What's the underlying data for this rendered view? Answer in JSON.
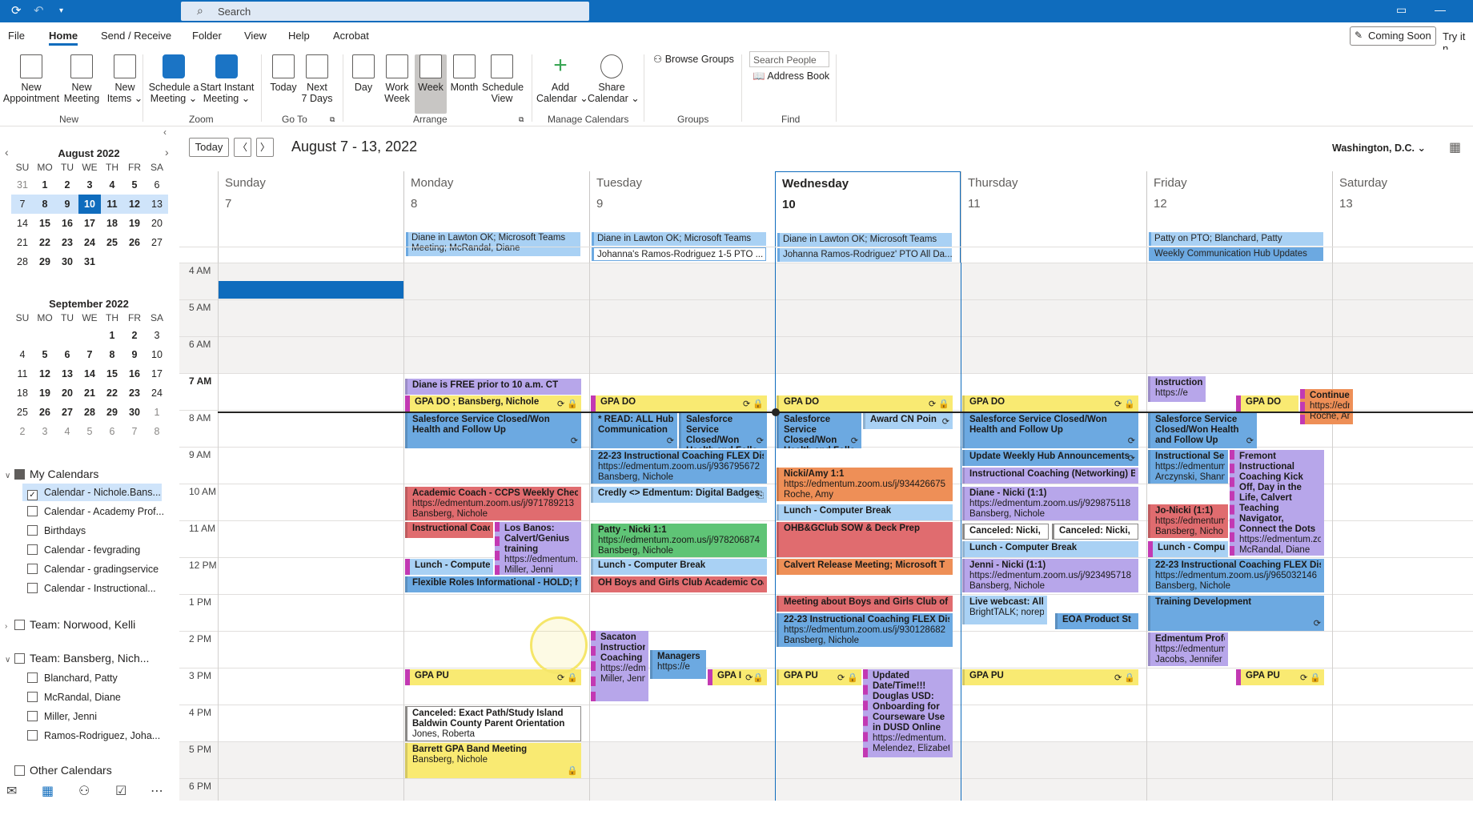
{
  "titlebar": {
    "search_placeholder": "Search",
    "icons": [
      "sync-icon",
      "undo-icon",
      "customize-icon",
      "restore-icon",
      "minimize-icon"
    ]
  },
  "menu": {
    "items": [
      "File",
      "Home",
      "Send / Receive",
      "Folder",
      "View",
      "Help",
      "Acrobat"
    ],
    "active": "Home",
    "coming_soon": "Coming Soon",
    "try_it": "Try it n"
  },
  "ribbon": {
    "new": {
      "appointment": "New\nAppointment",
      "meeting": "New\nMeeting",
      "items": "New\nItems ⌄",
      "group": "New"
    },
    "zoom": {
      "schedule": "Schedule a\nMeeting ⌄",
      "instant": "Start Instant\nMeeting ⌄",
      "group": "Zoom"
    },
    "goto": {
      "today": "Today",
      "next7": "Next\n7 Days",
      "group": "Go To"
    },
    "arrange": {
      "day": "Day",
      "workweek": "Work\nWeek",
      "week": "Week",
      "month": "Month",
      "schedule": "Schedule\nView",
      "group": "Arrange"
    },
    "manage": {
      "add": "Add\nCalendar ⌄",
      "share": "Share\nCalendar ⌄",
      "group": "Manage Calendars"
    },
    "groups": {
      "browse": "Browse Groups",
      "group": "Groups"
    },
    "find": {
      "search_people": "Search People",
      "address_book": "Address Book",
      "group": "Find"
    }
  },
  "mini_cals": [
    {
      "title": "August 2022",
      "dow": [
        "SU",
        "MO",
        "TU",
        "WE",
        "TH",
        "FR",
        "SA"
      ],
      "weeks": [
        [
          "31",
          "1",
          "2",
          "3",
          "4",
          "5",
          "6"
        ],
        [
          "7",
          "8",
          "9",
          "10",
          "11",
          "12",
          "13"
        ],
        [
          "14",
          "15",
          "16",
          "17",
          "18",
          "19",
          "20"
        ],
        [
          "21",
          "22",
          "23",
          "24",
          "25",
          "26",
          "27"
        ],
        [
          "28",
          "29",
          "30",
          "31",
          "",
          "",
          ""
        ]
      ]
    },
    {
      "title": "September 2022",
      "dow": [
        "SU",
        "MO",
        "TU",
        "WE",
        "TH",
        "FR",
        "SA"
      ],
      "weeks": [
        [
          "",
          "",
          "",
          "",
          "1",
          "2",
          "3"
        ],
        [
          "4",
          "5",
          "6",
          "7",
          "8",
          "9",
          "10"
        ],
        [
          "11",
          "12",
          "13",
          "14",
          "15",
          "16",
          "17"
        ],
        [
          "18",
          "19",
          "20",
          "21",
          "22",
          "23",
          "24"
        ],
        [
          "25",
          "26",
          "27",
          "28",
          "29",
          "30",
          "1"
        ],
        [
          "2",
          "3",
          "4",
          "5",
          "6",
          "7",
          "8"
        ]
      ]
    }
  ],
  "calendars": {
    "my_calendars": "My Calendars",
    "my_items": [
      "Calendar - Nichole.Bans...",
      "Calendar - Academy Prof...",
      "Birthdays",
      "Calendar - fevgrading",
      "Calendar - gradingservice",
      "Calendar - Instructional..."
    ],
    "team_norwood": "Team: Norwood, Kelli",
    "team_bansberg": "Team: Bansberg, Nich...",
    "team_items": [
      "Blanchard, Patty",
      "McRandal, Diane",
      "Miller, Jenni",
      "Ramos-Rodriguez, Joha..."
    ],
    "other": "Other Calendars"
  },
  "view": {
    "today_btn": "Today",
    "date_range": "August 7 - 13, 2022",
    "location": "Washington, D.C. ⌄",
    "days": [
      {
        "name": "Sunday",
        "num": "7"
      },
      {
        "name": "Monday",
        "num": "8"
      },
      {
        "name": "Tuesday",
        "num": "9"
      },
      {
        "name": "Wednesday",
        "num": "10"
      },
      {
        "name": "Thursday",
        "num": "11"
      },
      {
        "name": "Friday",
        "num": "12"
      },
      {
        "name": "Saturday",
        "num": "13"
      }
    ],
    "hours": [
      "4 AM",
      "5 AM",
      "6 AM",
      "7 AM",
      "8 AM",
      "9 AM",
      "10 AM",
      "11 AM",
      "12 PM",
      "1 PM",
      "2 PM",
      "3 PM",
      "4 PM",
      "5 PM",
      "6 PM"
    ]
  },
  "allday": {
    "mon1": "Diane in Lawton OK; Microsoft Teams Meeting; McRandal, Diane",
    "tue1": "Diane in Lawton OK; Microsoft Teams",
    "tue2": "Johanna's Ramos-Rodriguez 1-5 PTO ...",
    "wed1": "Diane in Lawton OK; Microsoft Teams",
    "wed2": "Johanna Ramos-Rodriguez' PTO All Da...",
    "fri1": "Patty on PTO; Blanchard, Patty",
    "fri2": "Weekly Communication Hub Updates"
  },
  "events": {
    "mon": {
      "free": "Diane is FREE prior to 10 a.m. CT",
      "gpado": "GPA DO ; Bansberg, Nichole",
      "sf_t": "Salesforce Service Closed/Won Health and Follow Up",
      "acad_t": "Academic Coach - CCPS Weekly Check In",
      "acad_u": "https://edmentum.zoom.us/j/971789213",
      "acad_p": "Bansberg, Nichole",
      "ic": "Instructional Coach",
      "losb_t": "Los Banos: Calvert/Genius training",
      "losb_u": "https://edmentum.",
      "losb_p": "Miller, Jenni",
      "lunch": "Lunch - Computer",
      "flex": "Flexible Roles Informational - HOLD; htt",
      "gpapu": "GPA PU",
      "cancel_t": "Canceled: Exact Path/Study Island Baldwin County Parent Orientation",
      "cancel_p": "Jones, Roberta",
      "band_t": "Barrett GPA Band Meeting",
      "band_p": "Bansberg, Nichole"
    },
    "tue": {
      "gpado": "GPA DO",
      "read_t": "* READ: ALL Hub Communication",
      "sf_t": "Salesforce Service Closed/Won Health and Follo",
      "coach_t": "22-23 Instructional Coaching FLEX Discu",
      "coach_u": "https://edmentum.zoom.us/j/936795672",
      "coach_p": "Bansberg, Nichole",
      "credly": "Credly <> Edmentum: Digital Badges",
      "patty_t": "Patty - Nicki 1:1",
      "patty_u": "https://edmentum.zoom.us/j/978206874",
      "patty_p": "Bansberg, Nichole",
      "lunch": "Lunch - Computer Break",
      "ohboys": "OH Boys and Girls Club Academic Coach",
      "sacaton_t": "Sacaton Instructional Coaching",
      "sacaton_u": "https://edm",
      "sacaton_p": "Miller, Jenn",
      "managers_t": "Managers C",
      "managers_u": "https://e",
      "gpa_short": "GPA I"
    },
    "wed": {
      "gpado": "GPA DO",
      "sf_t": "Salesforce Service Closed/Won Health and Follo",
      "award": "Award CN Poin",
      "amy_t": "Nicki/Amy 1:1",
      "amy_u": "https://edmentum.zoom.us/j/934426675",
      "amy_p": "Roche, Amy",
      "lunch": "Lunch - Computer Break",
      "ohbg": "OHB&GClub SOW & Deck Prep",
      "calvert": "Calvert Release Meeting; Microsoft T",
      "boys": "Meeting about Boys and Girls Club of O",
      "coach_t": "22-23 Instructional Coaching FLEX Discu",
      "coach_u": "https://edmentum.zoom.us/j/930128682",
      "coach_p": "Bansberg, Nichole",
      "gpapu": "GPA PU",
      "updated_t": "Updated Date/Time!!! Douglas USD: Onboarding for Courseware Use in DUSD Online",
      "updated_u": "https://edmentum.",
      "updated_p": "Melendez, Elizabet"
    },
    "thu": {
      "gpado": "GPA DO",
      "sf_t": "Salesforce Service Closed/Won Health and Follow Up",
      "hub": "Update Weekly Hub Announcements",
      "ic": "Instructional Coaching (Networking) Br",
      "diane_t": "Diane - Nicki (1:1)",
      "diane_u": "https://edmentum.zoom.us/j/929875118",
      "diane_p": "Bansberg, Nichole",
      "canc1": "Canceled: Nicki,",
      "canc2": "Canceled: Nicki,",
      "lunch": "Lunch - Computer Break",
      "jenni_t": "Jenni - Nicki (1:1)",
      "jenni_u": "https://edmentum.zoom.us/j/923495718",
      "jenni_p": "Bansberg, Nichole",
      "web_t": "Live webcast: All y",
      "web_u": "BrightTALK; norepl",
      "eoa": "EOA Product St",
      "gpapu": "GPA PU"
    },
    "fri": {
      "instr_t": "Instruction",
      "instr_u": "https://e",
      "gpado": "GPA DO",
      "cont_t": "Continued",
      "cont_u": "https://edm",
      "cont_p": "Roche, Amy",
      "sf_t": "Salesforce Service Closed/Won Health and Follow Up",
      "is_t": "Instructional Servic",
      "is_u": "https://edmentum.",
      "is_p": "Arczynski, Shann",
      "fremont_t": "Fremont Instructional Coaching Kick Off, Day in the Life, Calvert Teaching Navigator, Connect the Dots",
      "fremont_u": "https://edmentum.zoom.us/j/412206",
      "fremont_p": "McRandal, Diane",
      "jo_t": "Jo-Nicki (1:1)",
      "jo_u": "https://edmentum.",
      "jo_p": "Bansberg, Nicho",
      "lunch": "Lunch - Computer",
      "coach_t": "22-23 Instructional Coaching FLEX Discu",
      "coach_u": "https://edmentum.zoom.us/j/965032146",
      "coach_p": "Bansberg, Nichole",
      "training": "Training Development",
      "prof_t": "Edmentum Profess",
      "prof_u": "https://edmentum.",
      "prof_p": "Jacobs, Jennifer",
      "gpapu": "GPA PU"
    }
  },
  "colors": {
    "accent": "#0f6cbd",
    "blue_event": "#6ca9e1",
    "yellow_event": "#f9ea72",
    "purple_event": "#b7a6ea",
    "red_event": "#e06c6f",
    "green_event": "#5fc476",
    "orange_event": "#ee8f57"
  }
}
